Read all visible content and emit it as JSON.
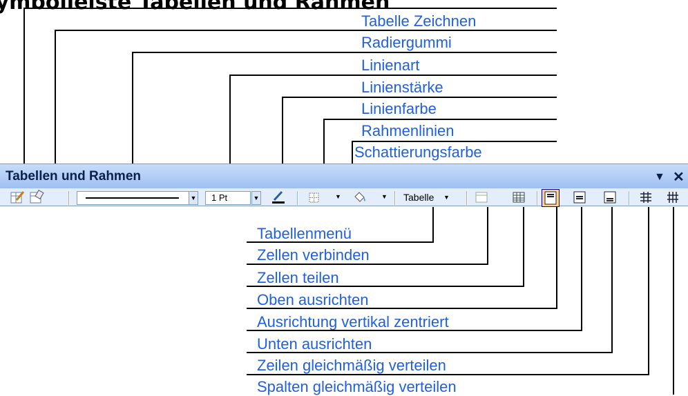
{
  "page": {
    "title": "Symbolleiste Tabellen und Rahmen"
  },
  "toolbar": {
    "title": "Tabellen und Rahmen",
    "line_weight": "1 Pt",
    "table_menu": "Tabelle"
  },
  "labels_top": [
    "Tabelle Zeichnen",
    "Radiergummi",
    "Linienart",
    "Linienstärke",
    "Linienfarbe",
    "Rahmenlinien",
    "Schattierungsfarbe"
  ],
  "labels_bottom": [
    "Tabellenmenü",
    "Zellen verbinden",
    "Zellen teilen",
    "Oben ausrichten",
    "Ausrichtung vertikal zentriert",
    "Unten ausrichten",
    "Zeilen gleichmäßig verteilen",
    "Spalten gleichmäßig verteilen"
  ],
  "colors": {
    "label": "#1f5fe0",
    "line": "#000000",
    "toolbar_bg": "#e4eefa",
    "title_bg": "#9fc0f2",
    "active": "#ffd38a"
  }
}
